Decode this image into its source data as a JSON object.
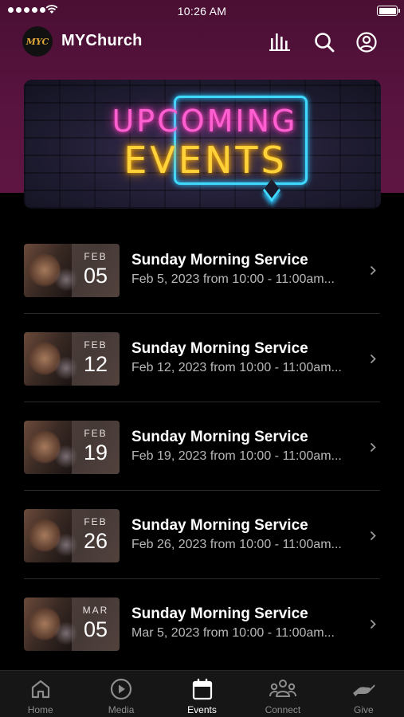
{
  "status_bar": {
    "time": "10:26 AM"
  },
  "app": {
    "title": "MYChurch",
    "logo_text": "MYC"
  },
  "banner": {
    "line1": "UPCOMING",
    "line2": "EVENTS"
  },
  "events": [
    {
      "month": "FEB",
      "day": "05",
      "title": "Sunday Morning Service",
      "subtitle": "Feb 5, 2023 from 10:00 - 11:00am..."
    },
    {
      "month": "FEB",
      "day": "12",
      "title": "Sunday Morning Service",
      "subtitle": "Feb 12, 2023 from 10:00 - 11:00am..."
    },
    {
      "month": "FEB",
      "day": "19",
      "title": "Sunday Morning Service",
      "subtitle": "Feb 19, 2023 from 10:00 - 11:00am..."
    },
    {
      "month": "FEB",
      "day": "26",
      "title": "Sunday Morning Service",
      "subtitle": "Feb 26, 2023 from 10:00 - 11:00am..."
    },
    {
      "month": "MAR",
      "day": "05",
      "title": "Sunday Morning Service",
      "subtitle": "Mar 5, 2023 from 10:00 - 11:00am..."
    }
  ],
  "tabs": [
    {
      "label": "Home",
      "icon": "home-icon"
    },
    {
      "label": "Media",
      "icon": "play-icon"
    },
    {
      "label": "Events",
      "icon": "calendar-icon",
      "active": true
    },
    {
      "label": "Connect",
      "icon": "people-icon"
    },
    {
      "label": "Give",
      "icon": "hand-icon"
    }
  ],
  "colors": {
    "header_bg": "#5a1440",
    "accent_neon_pink": "#ff5fd0",
    "accent_neon_yellow": "#ffd23a",
    "accent_neon_blue": "#3fd9ff"
  }
}
